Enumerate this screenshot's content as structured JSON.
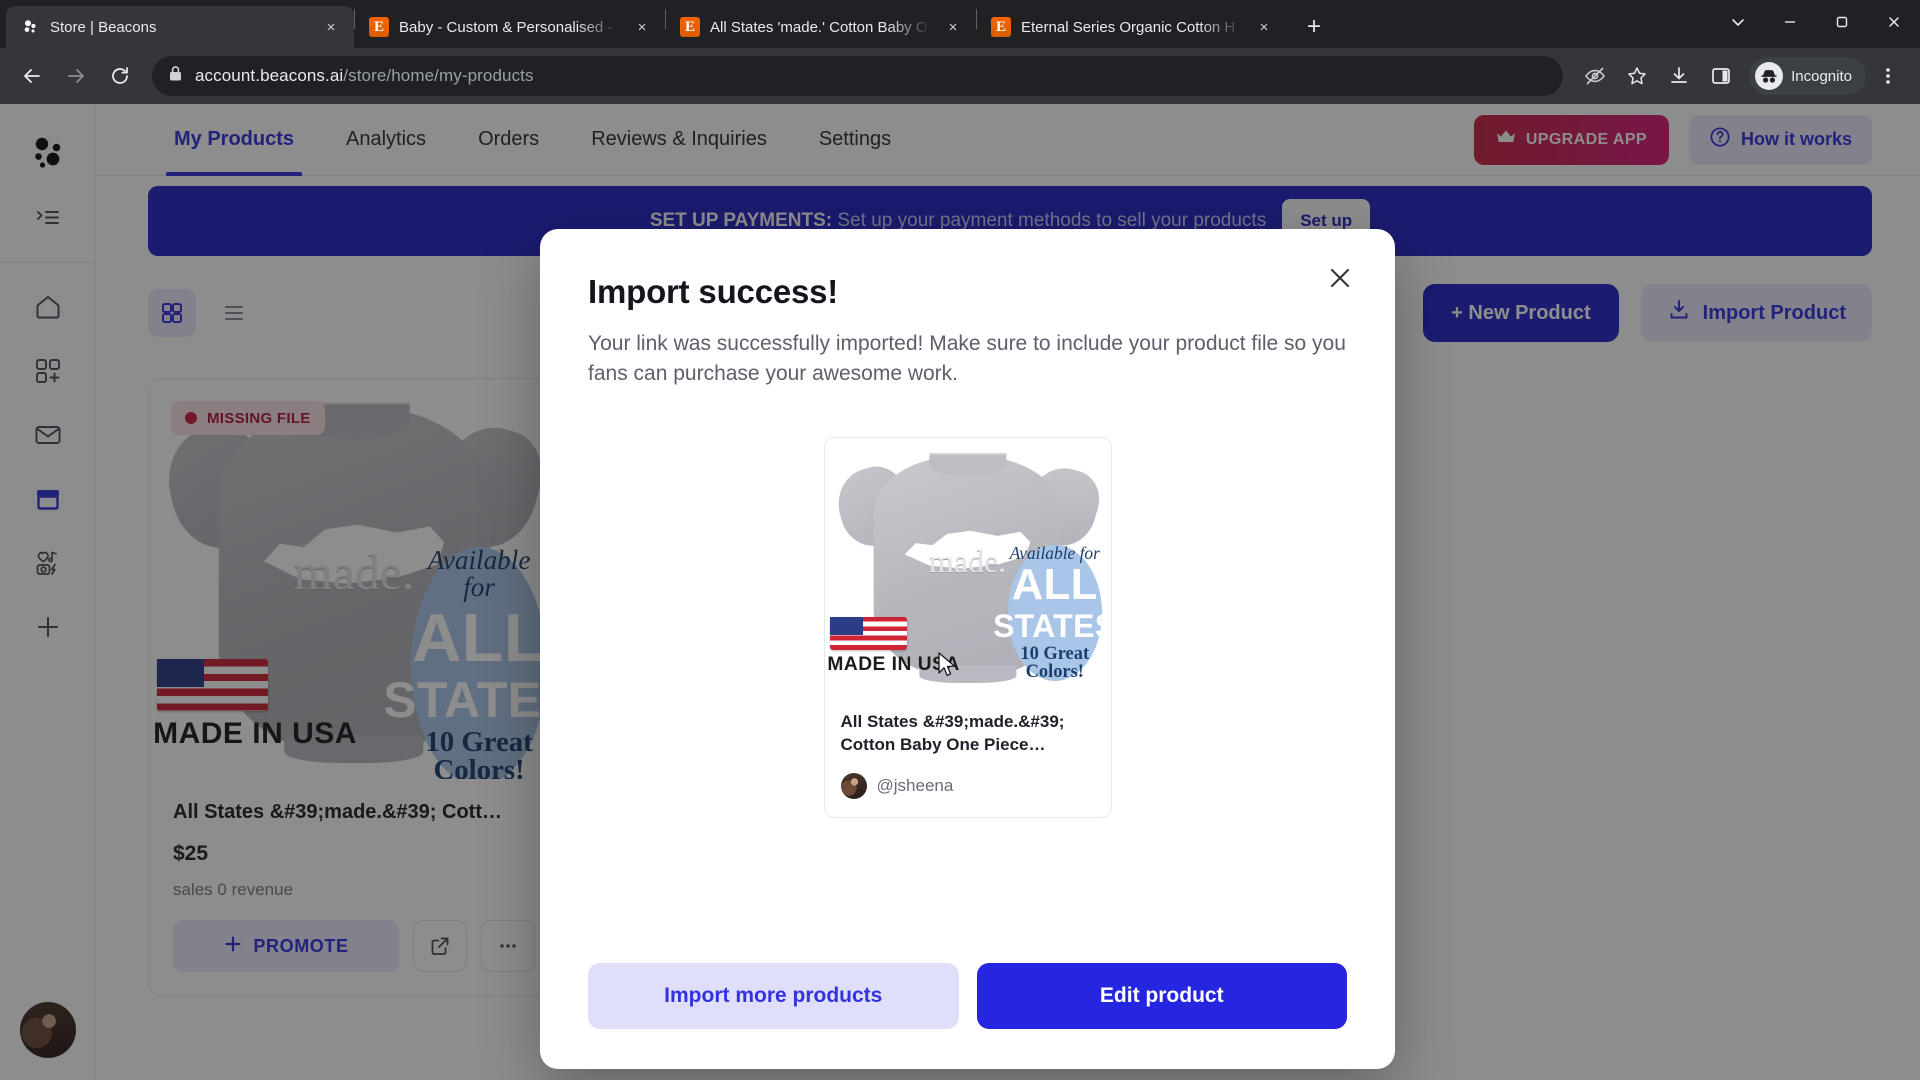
{
  "browser": {
    "tabs": [
      {
        "title": "Store | Beacons",
        "favicon": "beacons-icon",
        "active": true,
        "close_label": "×"
      },
      {
        "title": "Baby - Custom & Personalised -",
        "favicon": "etsy-icon",
        "active": false,
        "close_label": "×"
      },
      {
        "title": "All States 'made.' Cotton Baby O",
        "favicon": "etsy-icon",
        "active": false,
        "close_label": "×"
      },
      {
        "title": "Eternal Series Organic Cotton H",
        "favicon": "etsy-icon",
        "active": false,
        "close_label": "×"
      }
    ],
    "new_tab_label": "+",
    "window_controls": {
      "minimize": "minimize-icon",
      "maximize": "maximize-icon",
      "close": "close-icon",
      "tab_search": "chevron-down-icon"
    },
    "url_domain": "account.beacons.ai",
    "url_path": "/store/home/my-products",
    "back": "back-arrow-icon",
    "forward": "forward-arrow-icon",
    "reload": "reload-icon",
    "lock": "lock-icon",
    "omni_icons": [
      "eye-slash-icon",
      "star-icon",
      "download-icon",
      "side-panel-icon"
    ],
    "profile_label": "Incognito",
    "menu": "three-dot-menu-icon"
  },
  "sidebar": {
    "logo": "beacons-logo-icon",
    "collapse": "collapse-panel-icon",
    "items": [
      {
        "icon": "home-icon",
        "name": "home",
        "active": false
      },
      {
        "icon": "apps-add-icon",
        "name": "apps",
        "active": false
      },
      {
        "icon": "mail-icon",
        "name": "mail",
        "active": false
      },
      {
        "icon": "store-icon",
        "name": "store",
        "active": true
      },
      {
        "icon": "media-kit-icon",
        "name": "media-kit",
        "active": false
      },
      {
        "icon": "plus-icon",
        "name": "add",
        "active": false
      }
    ],
    "avatar": "user-avatar"
  },
  "topnav": {
    "tabs": [
      {
        "label": "My Products",
        "active": true
      },
      {
        "label": "Analytics",
        "active": false
      },
      {
        "label": "Orders",
        "active": false
      },
      {
        "label": "Reviews & Inquiries",
        "active": false
      },
      {
        "label": "Settings",
        "active": false
      }
    ],
    "upgrade_label": "UPGRADE APP",
    "upgrade_icon": "crown-icon",
    "how_it_works_label": "How it works",
    "how_it_works_icon": "question-circle-icon"
  },
  "banner": {
    "strong": "SET UP PAYMENTS:",
    "text": "Set up your payment methods to sell your products",
    "button_label": "Set up"
  },
  "toolbar": {
    "grid_view_icon": "grid-view-icon",
    "list_view_icon": "list-view-icon",
    "new_product_label": "+ New Product",
    "import_product_label": "Import Product",
    "import_icon": "download-tray-icon"
  },
  "product_card": {
    "badge_label": "MISSING FILE",
    "title": "All States &#39;made.&#39; Cott…",
    "price": "$25",
    "stats": "sales   0 revenue",
    "promote_label": "PROMOTE",
    "promote_icon": "plus-icon",
    "open_icon": "external-link-icon",
    "more_icon": "ellipsis-icon",
    "image": {
      "made_text": "made.",
      "circle_line1": "Available for",
      "circle_line2": "ALL",
      "circle_line3": "STATES",
      "circle_line4": "10 Great Colors!",
      "flag_caption": "MADE IN USA"
    }
  },
  "modal": {
    "close_icon": "close-icon",
    "title": "Import success!",
    "subtitle": "Your link was successfully imported! Make sure to include your product file so you fans can purchase your awesome work.",
    "preview": {
      "title": "All States &#39;made.&#39; Cotton Baby One Piece…",
      "author": "@jsheena",
      "image": {
        "made_text": "made.",
        "circle_line1": "Available for",
        "circle_line2": "ALL",
        "circle_line3": "STATES",
        "circle_line4": "10 Great Colors!",
        "flag_caption": "MADE IN USA"
      }
    },
    "import_more_label": "Import more products",
    "edit_product_label": "Edit product"
  },
  "colors": {
    "brand_blue": "#3333dd",
    "primary_button": "#2626e0",
    "banner_blue": "#2626c7",
    "upgrade_start": "#c62645",
    "upgrade_end": "#d81b7e",
    "badge_bg": "#fbe3e8",
    "badge_fg": "#b0173c",
    "chrome_dark": "#202124",
    "chrome_toolbar": "#35363a"
  }
}
